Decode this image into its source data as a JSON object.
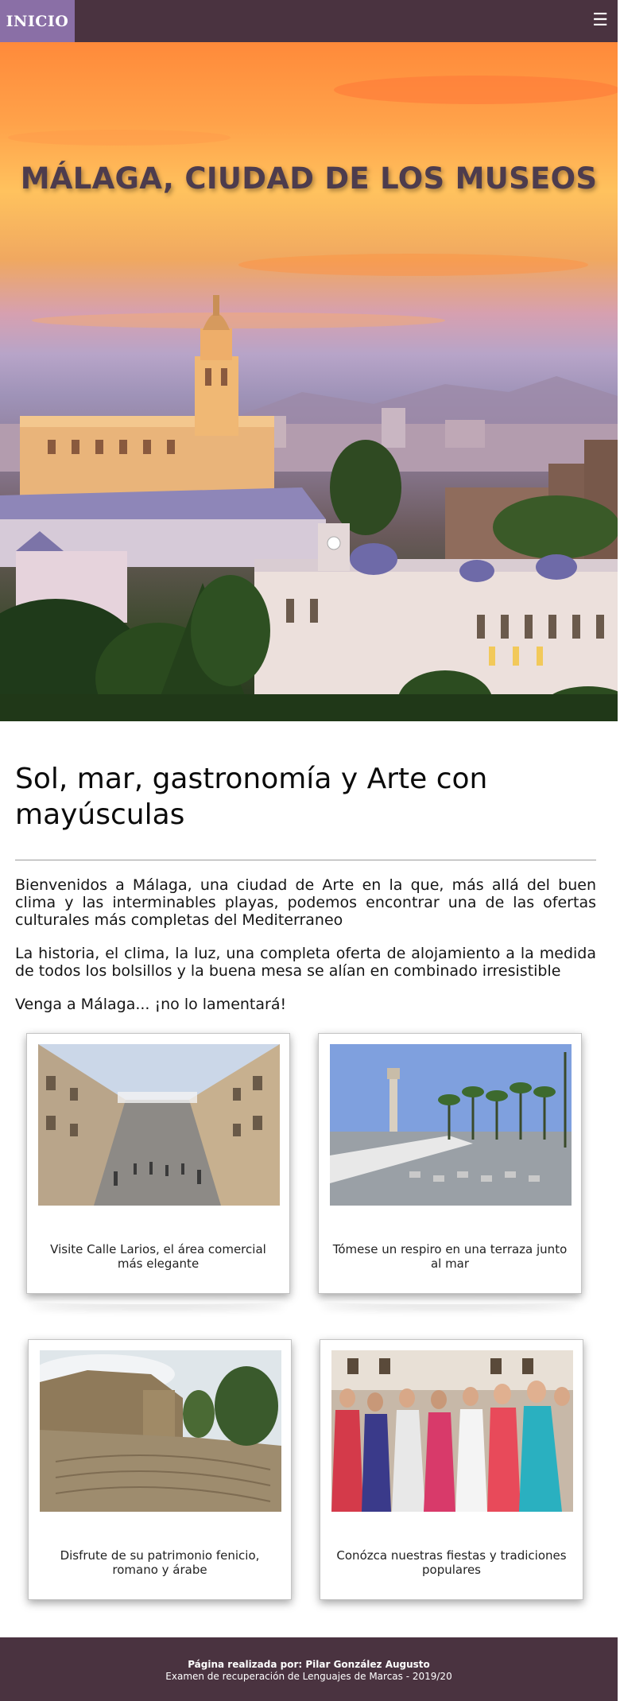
{
  "nav": {
    "home_label": "INICIO",
    "menu_glyph": "☰"
  },
  "hero": {
    "title": "MÁLAGA, CIUDAD DE LOS MUSEOS"
  },
  "intro": {
    "heading": "Sol, mar, gastronomía y Arte con mayúsculas",
    "paragraphs": [
      "Bienvenidos a Málaga, una ciudad de Arte en la que, más allá del buen clima y las interminables playas, podemos encontrar una de las ofertas culturales más completas del Mediterraneo",
      "La historia, el clima, la luz, una completa oferta de alojamiento a la medida de todos los bolsillos y la buena mesa se alían en combinado irresistible",
      "Venga a Málaga... ¡no lo lamentará!"
    ]
  },
  "cards": [
    {
      "caption": "Visite Calle Larios, el área comercial más elegante"
    },
    {
      "caption": "Tómese un respiro en una terraza junto al mar"
    },
    {
      "caption": "Disfrute de su patrimonio fenicio, romano y árabe"
    },
    {
      "caption": "Conózca nuestras fiestas y tradiciones populares"
    }
  ],
  "footer": {
    "line1": "Página realizada por: Pilar González Augusto",
    "line2": "Examen de recuperación de Lenguajes de Marcas - 2019/20"
  },
  "colors": {
    "nav_bg": "#4a3340",
    "home_bg": "#8a6fa6",
    "title_color": "#4d3c4d"
  }
}
